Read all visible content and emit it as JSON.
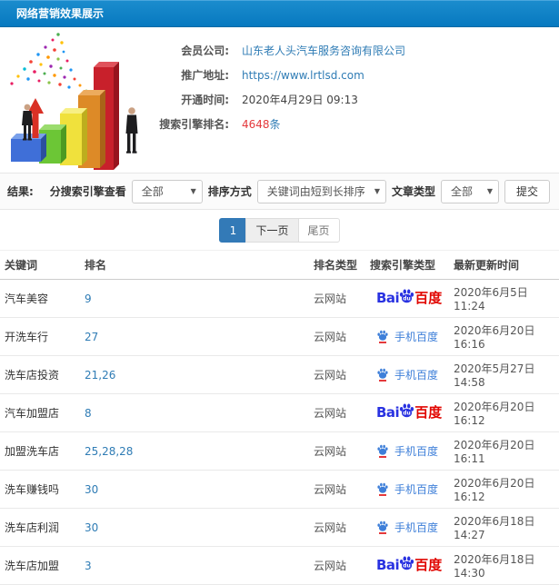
{
  "title_bar": {
    "title": "网络营销效果展示"
  },
  "header_info": {
    "rows": [
      {
        "label": "会员公司:",
        "value": "山东老人头汽车服务咨询有限公司"
      },
      {
        "label": "推广地址:",
        "value": "https://www.lrtlsd.com"
      },
      {
        "label": "开通时间:",
        "value": "2020年4月29日 09:13"
      },
      {
        "label": "搜索引擎排名:",
        "count": "4648",
        "unit": "条"
      }
    ]
  },
  "filters": {
    "result_label": "结果:",
    "engine_filter_label": "分搜索引擎查看",
    "engine_filter_value": "全部",
    "sort_label": "排序方式",
    "sort_value": "关键词由短到长排序",
    "type_label": "文章类型",
    "type_value": "全部",
    "submit_label": "提交"
  },
  "pagination": {
    "current": "1",
    "next": "下一页",
    "last": "尾页"
  },
  "engines": {
    "baidu": {
      "bai": "Bai",
      "du": "du",
      "cn": "百度"
    },
    "mobile": {
      "label": "手机百度"
    }
  },
  "table": {
    "columns": [
      "关键词",
      "排名",
      "排名类型",
      "搜索引擎类型",
      "最新更新时间"
    ],
    "rows": [
      {
        "keyword": "汽车美容",
        "rank": "9",
        "rank_type": "云网站",
        "engine": "baidu",
        "updated": "2020年6月5日 11:24"
      },
      {
        "keyword": "开洗车行",
        "rank": "27",
        "rank_type": "云网站",
        "engine": "mobile",
        "updated": "2020年6月20日 16:16"
      },
      {
        "keyword": "洗车店投资",
        "rank": "21,26",
        "rank_type": "云网站",
        "engine": "mobile",
        "updated": "2020年5月27日 14:58"
      },
      {
        "keyword": "汽车加盟店",
        "rank": "8",
        "rank_type": "云网站",
        "engine": "baidu",
        "updated": "2020年6月20日 16:12"
      },
      {
        "keyword": "加盟洗车店",
        "rank": "25,28,28",
        "rank_type": "云网站",
        "engine": "mobile",
        "updated": "2020年6月20日 16:11"
      },
      {
        "keyword": "洗车赚钱吗",
        "rank": "30",
        "rank_type": "云网站",
        "engine": "mobile",
        "updated": "2020年6月20日 16:12"
      },
      {
        "keyword": "洗车店利润",
        "rank": "30",
        "rank_type": "云网站",
        "engine": "mobile",
        "updated": "2020年6月18日 14:27"
      },
      {
        "keyword": "洗车店加盟",
        "rank": "3",
        "rank_type": "云网站",
        "engine": "baidu",
        "updated": "2020年6月18日 14:30"
      }
    ]
  },
  "colors": {
    "title_bar_blue": "#0780c6",
    "link_blue": "#2f7cb5",
    "count_red": "#e4393c",
    "baidu_blue": "#2932e1",
    "baidu_red": "#e10601",
    "mobile_baidu_blue": "#3e7fd9",
    "pagination_active": "#337ab7"
  }
}
